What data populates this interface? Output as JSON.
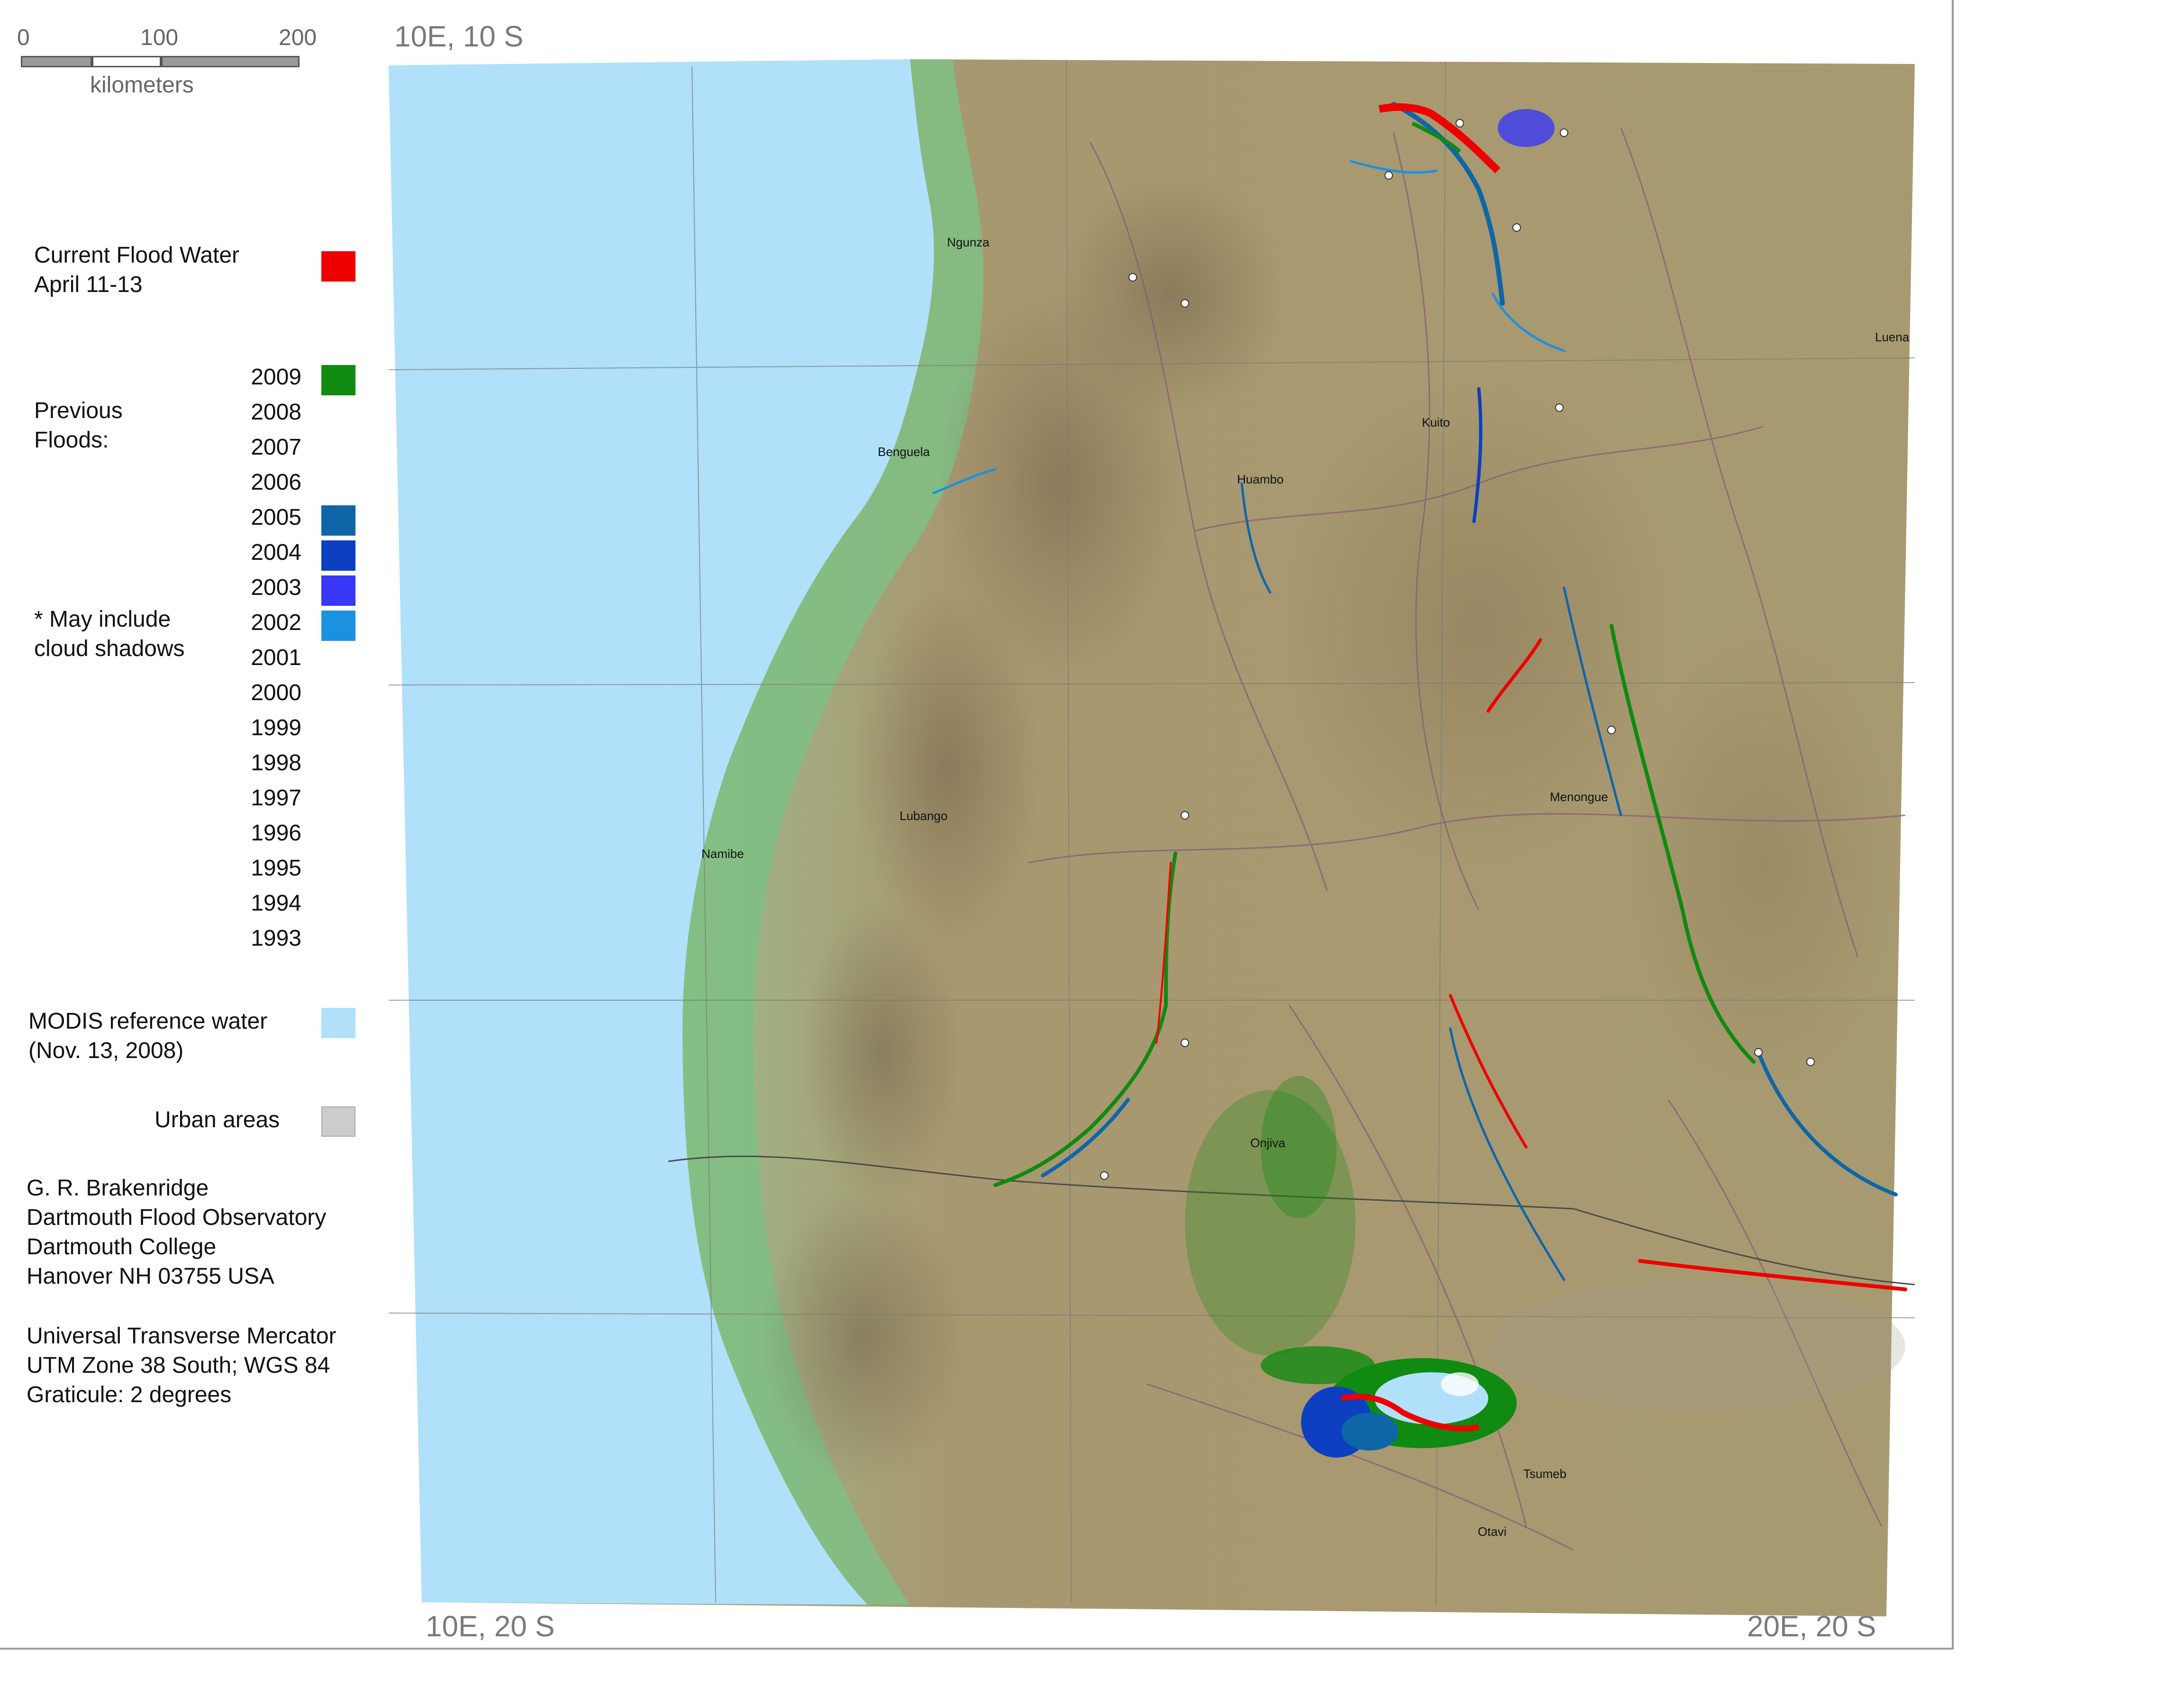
{
  "scale": {
    "ticks": [
      "0",
      "100",
      "200"
    ],
    "unit": "kilometers"
  },
  "corners": {
    "top_left": "10E, 10 S",
    "bottom_left": "10E, 20 S",
    "bottom_right": "20E, 20 S"
  },
  "legend": {
    "current_flood": {
      "title": "Current Flood Water",
      "dates": "April 11-13",
      "color": "#ee0000"
    },
    "previous_label_line1": "Previous",
    "previous_label_line2": "Floods:",
    "note_line1": "* May include",
    "note_line2": "cloud shadows",
    "years": [
      {
        "year": "2009",
        "color": "#108a10"
      },
      {
        "year": "2008",
        "color": ""
      },
      {
        "year": "2007",
        "color": ""
      },
      {
        "year": "2006",
        "color": ""
      },
      {
        "year": "2005",
        "color": "#0e66a8"
      },
      {
        "year": "2004",
        "color": "#0c40c0"
      },
      {
        "year": "2003",
        "color": "#3838f4"
      },
      {
        "year": "2002",
        "color": "#1a92e0"
      },
      {
        "year": "2001",
        "color": ""
      },
      {
        "year": "2000",
        "color": ""
      },
      {
        "year": "1999",
        "color": ""
      },
      {
        "year": "1998",
        "color": ""
      },
      {
        "year": "1997",
        "color": ""
      },
      {
        "year": "1996",
        "color": ""
      },
      {
        "year": "1995",
        "color": ""
      },
      {
        "year": "1994",
        "color": ""
      },
      {
        "year": "1993",
        "color": ""
      }
    ],
    "modis": {
      "title": "MODIS reference water",
      "date": "(Nov. 13, 2008)",
      "color": "#b0e0fa"
    },
    "urban": {
      "title": "Urban areas",
      "color": "#cccccc"
    }
  },
  "credits": [
    "G. R. Brakenridge",
    "Dartmouth Flood Observatory",
    "Dartmouth College",
    "Hanover NH 03755 USA"
  ],
  "projection": [
    "Universal Transverse Mercator",
    "UTM Zone 38 South; WGS 84",
    "Graticule:  2 degrees"
  ],
  "places": {
    "ngunza": "Ngunza",
    "benguela": "Benguela",
    "huambo": "Huambo",
    "kuito": "Kuito",
    "luena": "Luena",
    "lubango": "Lubango",
    "namibe": "Namibe",
    "menongue": "Menongue",
    "onjiva": "Onjiva",
    "tsumeb": "Tsumeb",
    "otavi": "Otavi"
  },
  "colors": {
    "ocean": "#b0e0fa",
    "coast_green": "#7ab882",
    "land": "#a89870",
    "boundary": "#8a5a7a",
    "graticule": "#7a7a7a"
  }
}
